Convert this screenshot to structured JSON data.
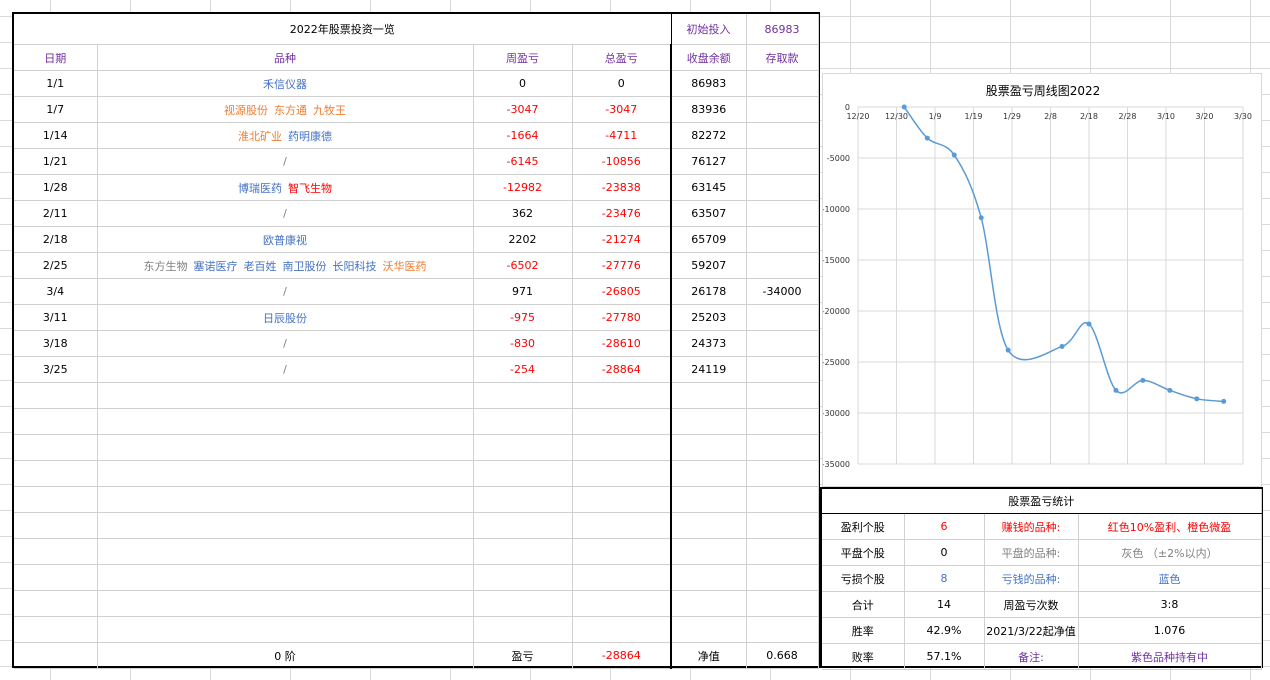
{
  "sheet": {
    "title": "2022年股票投资一览",
    "initial_label": "初始投入",
    "initial_value": "86983",
    "headers": {
      "date": "日期",
      "stock": "品种",
      "week_pl": "周盈亏",
      "total_pl": "总盈亏",
      "balance": "收盘余额",
      "deposit": "存取款"
    },
    "rows": [
      {
        "date": "1/1",
        "stocks": [
          {
            "name": "禾信仪器",
            "color": "#4472c4"
          }
        ],
        "week": "0",
        "week_color": "#000000",
        "total": "0",
        "total_color": "#000000",
        "balance": "86983",
        "deposit": ""
      },
      {
        "date": "1/7",
        "stocks": [
          {
            "name": "视源股份",
            "color": "#ed7d31"
          },
          {
            "name": "东方通",
            "color": "#ed7d31"
          },
          {
            "name": "九牧王",
            "color": "#ed7d31"
          }
        ],
        "week": "-3047",
        "week_color": "#ff0000",
        "total": "-3047",
        "total_color": "#ff0000",
        "balance": "83936",
        "deposit": ""
      },
      {
        "date": "1/14",
        "stocks": [
          {
            "name": "淮北矿业",
            "color": "#ed7d31"
          },
          {
            "name": "药明康德",
            "color": "#4472c4"
          }
        ],
        "week": "-1664",
        "week_color": "#ff0000",
        "total": "-4711",
        "total_color": "#ff0000",
        "balance": "82272",
        "deposit": ""
      },
      {
        "date": "1/21",
        "stocks": [
          {
            "name": "/",
            "color": "#808080"
          }
        ],
        "week": "-6145",
        "week_color": "#ff0000",
        "total": "-10856",
        "total_color": "#ff0000",
        "balance": "76127",
        "deposit": ""
      },
      {
        "date": "1/28",
        "stocks": [
          {
            "name": "博瑞医药",
            "color": "#4472c4"
          },
          {
            "name": "智飞生物",
            "color": "#ff0000"
          }
        ],
        "week": "-12982",
        "week_color": "#ff0000",
        "total": "-23838",
        "total_color": "#ff0000",
        "balance": "63145",
        "deposit": ""
      },
      {
        "date": "2/11",
        "stocks": [
          {
            "name": "/",
            "color": "#808080"
          }
        ],
        "week": "362",
        "week_color": "#000000",
        "total": "-23476",
        "total_color": "#ff0000",
        "balance": "63507",
        "deposit": ""
      },
      {
        "date": "2/18",
        "stocks": [
          {
            "name": "欧普康视",
            "color": "#4472c4"
          }
        ],
        "week": "2202",
        "week_color": "#000000",
        "total": "-21274",
        "total_color": "#ff0000",
        "balance": "65709",
        "deposit": ""
      },
      {
        "date": "2/25",
        "stocks": [
          {
            "name": "东方生物",
            "color": "#808080"
          },
          {
            "name": "塞诺医疗",
            "color": "#4472c4"
          },
          {
            "name": "老百姓",
            "color": "#4472c4"
          },
          {
            "name": "南卫股份",
            "color": "#4472c4"
          },
          {
            "name": "长阳科技",
            "color": "#4472c4"
          },
          {
            "name": "沃华医药",
            "color": "#ed7d31"
          }
        ],
        "week": "-6502",
        "week_color": "#ff0000",
        "total": "-27776",
        "total_color": "#ff0000",
        "balance": "59207",
        "deposit": ""
      },
      {
        "date": "3/4",
        "stocks": [
          {
            "name": "/",
            "color": "#808080"
          }
        ],
        "week": "971",
        "week_color": "#000000",
        "total": "-26805",
        "total_color": "#ff0000",
        "balance": "26178",
        "deposit": "-34000"
      },
      {
        "date": "3/11",
        "stocks": [
          {
            "name": "日辰股份",
            "color": "#4472c4"
          }
        ],
        "week": "-975",
        "week_color": "#ff0000",
        "total": "-27780",
        "total_color": "#ff0000",
        "balance": "25203",
        "deposit": ""
      },
      {
        "date": "3/18",
        "stocks": [
          {
            "name": "/",
            "color": "#808080"
          }
        ],
        "week": "-830",
        "week_color": "#ff0000",
        "total": "-28610",
        "total_color": "#ff0000",
        "balance": "24373",
        "deposit": ""
      },
      {
        "date": "3/25",
        "stocks": [
          {
            "name": "/",
            "color": "#808080"
          }
        ],
        "week": "-254",
        "week_color": "#ff0000",
        "total": "-28864",
        "total_color": "#ff0000",
        "balance": "24119",
        "deposit": ""
      }
    ],
    "summary": {
      "steps": "0 阶",
      "pl_label": "盈亏",
      "pl_value": "-28864",
      "net_label": "净值",
      "net_value": "0.668"
    }
  },
  "chart_data": {
    "type": "line",
    "title": "股票盈亏周线图2022",
    "x_ticks": [
      "12/20",
      "12/30",
      "1/9",
      "1/19",
      "1/29",
      "2/8",
      "2/18",
      "2/28",
      "3/10",
      "3/20",
      "3/30"
    ],
    "y_ticks": [
      "0",
      "-5000",
      "-10000",
      "-15000",
      "-20000",
      "-25000",
      "-30000",
      "-35000"
    ],
    "ylim": [
      -35000,
      0
    ],
    "x": [
      "1/1",
      "1/7",
      "1/14",
      "1/21",
      "1/28",
      "2/11",
      "2/18",
      "2/25",
      "3/4",
      "3/11",
      "3/18",
      "3/25"
    ],
    "y": [
      0,
      -3047,
      -4711,
      -10856,
      -23838,
      -23476,
      -21274,
      -27776,
      -26805,
      -27780,
      -28610,
      -28864
    ],
    "line_color": "#5b9bd5",
    "grid": true
  },
  "stats": {
    "title": "股票盈亏统计",
    "rows": [
      {
        "label": "盈利个股",
        "value": "6",
        "value_color": "#ff0000",
        "key": "赚钱的品种:",
        "key_color": "#ff0000",
        "desc": "红色10%盈利、橙色微盈",
        "desc_color": "#ff0000"
      },
      {
        "label": "平盘个股",
        "value": "0",
        "value_color": "#000000",
        "key": "平盘的品种:",
        "key_color": "#808080",
        "desc": "灰色 （±2%以内）",
        "desc_color": "#808080"
      },
      {
        "label": "亏损个股",
        "value": "8",
        "value_color": "#4472c4",
        "key": "亏钱的品种:",
        "key_color": "#4472c4",
        "desc": "蓝色",
        "desc_color": "#4472c4"
      },
      {
        "label": "合计",
        "value": "14",
        "value_color": "#000000",
        "key": "周盈亏次数",
        "key_color": "#000000",
        "desc": "3:8",
        "desc_color": "#000000"
      },
      {
        "label": "胜率",
        "value": "42.9%",
        "value_color": "#000000",
        "key": "2021/3/22起净值",
        "key_color": "#000000",
        "desc": "1.076",
        "desc_color": "#000000"
      },
      {
        "label": "败率",
        "value": "57.1%",
        "value_color": "#000000",
        "key": "备注:",
        "key_color": "#7030a0",
        "desc": "紫色品种持有中",
        "desc_color": "#7030a0"
      }
    ]
  }
}
